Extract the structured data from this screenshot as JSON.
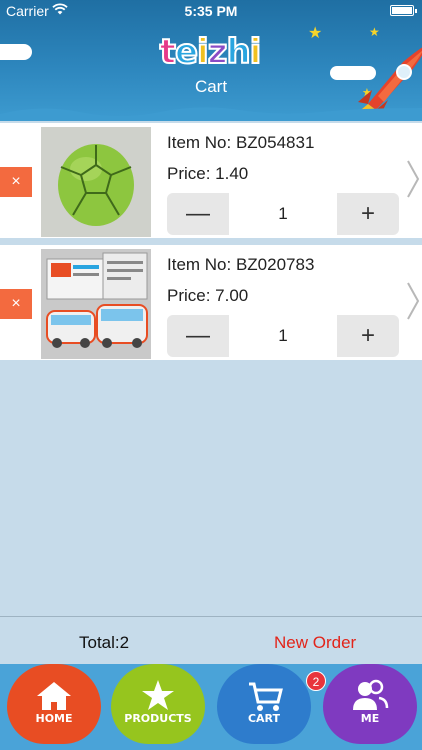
{
  "status_bar": {
    "carrier": "Carrier",
    "time": "5:35 PM"
  },
  "header": {
    "logo_text": "teizhi",
    "title": "Cart"
  },
  "cart": {
    "items": [
      {
        "item_no": "Item No: BZ054831",
        "price": "Price: 1.40",
        "quantity": "1",
        "delete_label": "×",
        "thumb": "green-ball-image"
      },
      {
        "item_no": "Item No: BZ020783",
        "price": "Price: 7.00",
        "quantity": "1",
        "delete_label": "×",
        "thumb": "toy-bus-image"
      }
    ],
    "minus_label": "—",
    "plus_label": "+"
  },
  "footer": {
    "total": "Total:2",
    "new_order": "New Order"
  },
  "tabs": [
    {
      "label": "HOME",
      "icon": "house-icon",
      "color": "#e84d23"
    },
    {
      "label": "PRODUCTS",
      "icon": "star-icon",
      "color": "#96c51e"
    },
    {
      "label": "CART",
      "icon": "cart-icon",
      "color": "#2e7ccc"
    },
    {
      "label": "ME",
      "icon": "users-icon",
      "color": "#7f3ac0"
    }
  ],
  "cart_badge": "2",
  "colors": {
    "header": "#2d86bd",
    "background": "#c6dbea",
    "delete": "#f36a3f",
    "new_order": "#e2241a"
  }
}
